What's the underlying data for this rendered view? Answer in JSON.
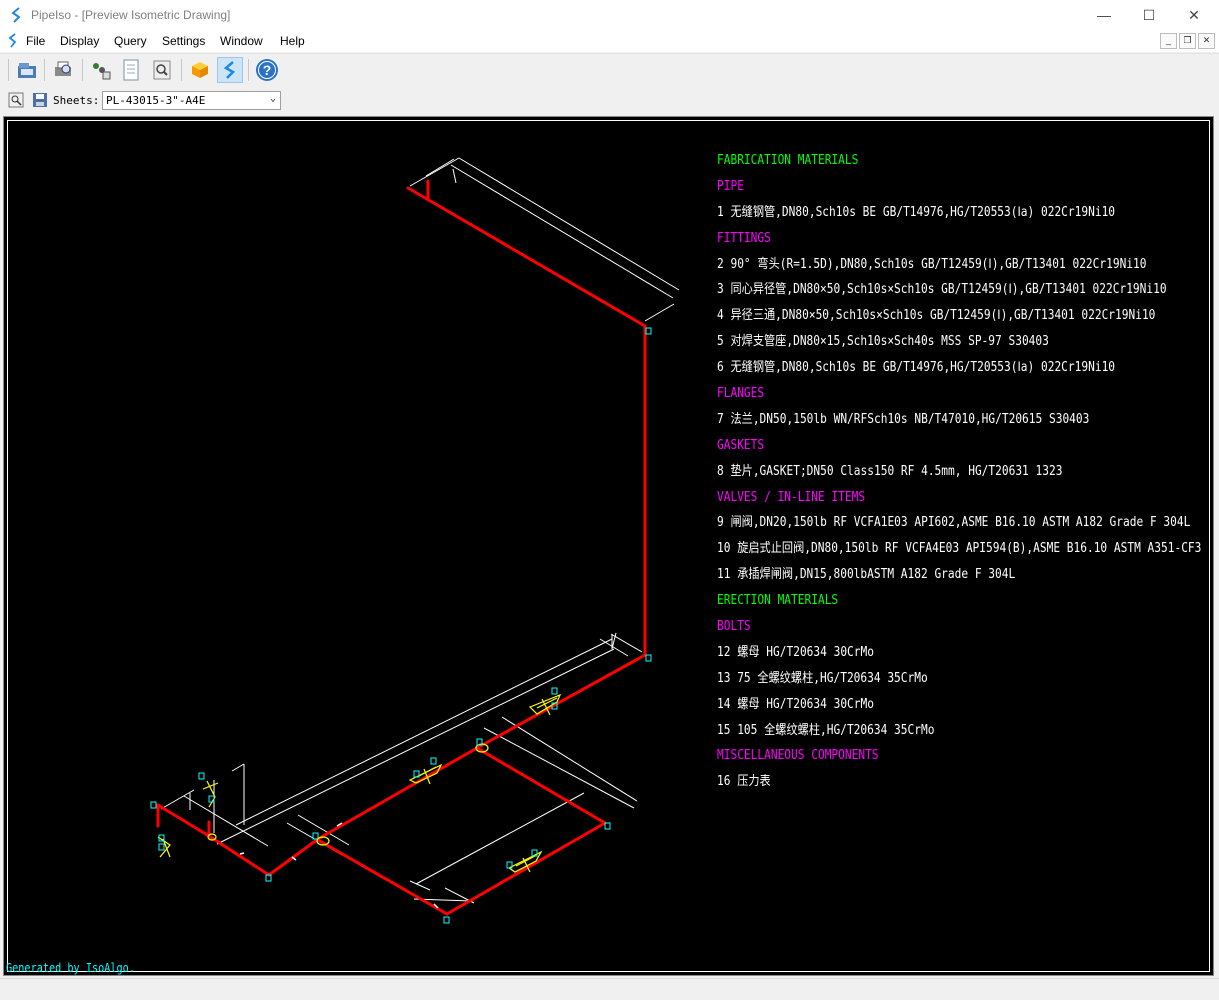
{
  "window": {
    "title": "PipeIso - [Preview Isometric Drawing]",
    "minimize_glyph": "—",
    "maximize_glyph": "☐",
    "close_glyph": "✕"
  },
  "menu": {
    "items": [
      {
        "label": "File"
      },
      {
        "label": "Display"
      },
      {
        "label": "Query"
      },
      {
        "label": "Settings"
      },
      {
        "label": "Window"
      },
      {
        "label": "Help"
      }
    ],
    "mdi_minimize": "_",
    "mdi_restore": "❐",
    "mdi_close": "✕"
  },
  "toolbar": {
    "icons": [
      "open-folder-icon",
      "print-preview-icon",
      "export-icon",
      "page-icon",
      "zoom-page-icon",
      "box-3d-icon",
      "pipeiso-logo-icon",
      "help-icon"
    ],
    "help_glyph": "?"
  },
  "sheetbar": {
    "label": "Sheets:",
    "selected": "PL-43015-3\"-A4E",
    "dropdown_arrow": "⌄"
  },
  "colors": {
    "pipe": "#ff0000",
    "dimension": "#ffffff",
    "fitting": "#ffff00",
    "node": "#00ffff",
    "heading": "#00ff00",
    "category": "#ff00ff"
  },
  "bom": {
    "lines": [
      {
        "text": "FABRICATION MATERIALS",
        "kind": "heading"
      },
      {
        "text": "PIPE",
        "kind": "category"
      },
      {
        "text": "1  无缝钢管,DN80,Sch10s BE GB/T14976,HG/T20553(Ⅰa) 022Cr19Ni10",
        "kind": "item"
      },
      {
        "text": "FITTINGS",
        "kind": "category"
      },
      {
        "text": "2  90° 弯头(R=1.5D),DN80,Sch10s GB/T12459(Ⅰ),GB/T13401 022Cr19Ni10",
        "kind": "item"
      },
      {
        "text": "3  同心异径管,DN80×50,Sch10s×Sch10s GB/T12459(Ⅰ),GB/T13401 022Cr19Ni10",
        "kind": "item"
      },
      {
        "text": "4  异径三通,DN80×50,Sch10s×Sch10s GB/T12459(Ⅰ),GB/T13401 022Cr19Ni10",
        "kind": "item"
      },
      {
        "text": "5  对焊支管座,DN80×15,Sch10s×Sch40s MSS SP-97 S30403",
        "kind": "item"
      },
      {
        "text": "6  无缝钢管,DN80,Sch10s BE GB/T14976,HG/T20553(Ⅰa) 022Cr19Ni10",
        "kind": "item"
      },
      {
        "text": "FLANGES",
        "kind": "category"
      },
      {
        "text": "7  法兰,DN50,150lb WN/RFSch10s NB/T47010,HG/T20615 S30403",
        "kind": "item"
      },
      {
        "text": "GASKETS",
        "kind": "category"
      },
      {
        "text": "8  垫片,GASKET;DN50 Class150 RF 4.5mm, HG/T20631 1323",
        "kind": "item"
      },
      {
        "text": "VALVES / IN-LINE ITEMS",
        "kind": "category"
      },
      {
        "text": "9  闸阀,DN20,150lb RF VCFA1E03 API602,ASME B16.10 ASTM A182 Grade F 304L",
        "kind": "item"
      },
      {
        "text": "10 旋启式止回阀,DN80,150lb RF VCFA4E03 API594(B),ASME B16.10 ASTM A351-CF3",
        "kind": "item"
      },
      {
        "text": "11 承插焊闸阀,DN15,800lbASTM A182 Grade F 304L",
        "kind": "item"
      },
      {
        "text": "ERECTION MATERIALS",
        "kind": "heading"
      },
      {
        "text": "BOLTS",
        "kind": "category"
      },
      {
        "text": "12 螺母 HG/T20634 30CrMo",
        "kind": "item"
      },
      {
        "text": "13 75 全螺纹螺柱,HG/T20634 35CrMo",
        "kind": "item"
      },
      {
        "text": "14 螺母 HG/T20634 30CrMo",
        "kind": "item"
      },
      {
        "text": "15 105 全螺纹螺柱,HG/T20634 35CrMo",
        "kind": "item"
      },
      {
        "text": "MISCELLANEOUS COMPONENTS",
        "kind": "category"
      },
      {
        "text": "16 压力表",
        "kind": "item"
      }
    ]
  },
  "footer": {
    "text": "Generated by IsoAlgo."
  }
}
